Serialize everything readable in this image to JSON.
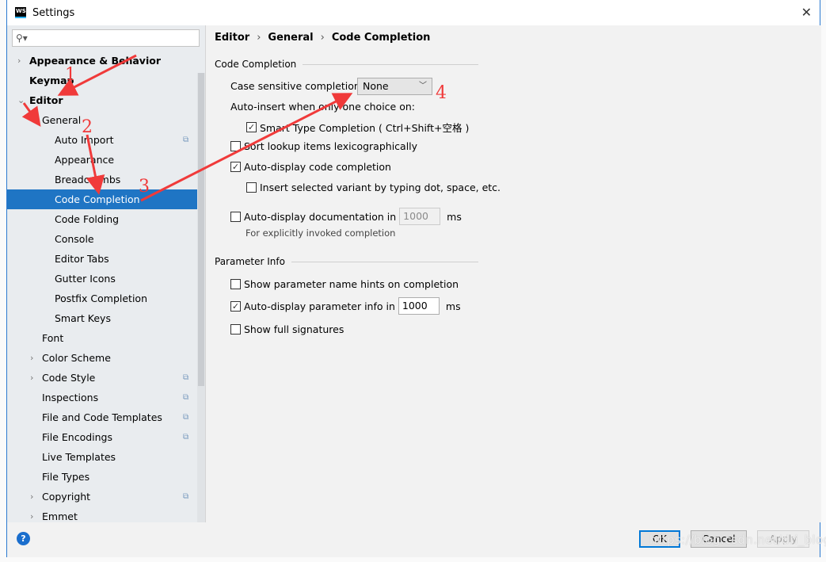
{
  "window": {
    "title": "Settings",
    "logo": "WS"
  },
  "search": {
    "placeholder": "",
    "icon": "search-icon"
  },
  "sidebar": {
    "items": [
      {
        "label": "Appearance & Behavior",
        "level": 0,
        "bold": true,
        "arrow": "›"
      },
      {
        "label": "Keymap",
        "level": 0,
        "bold": true,
        "arrow": ""
      },
      {
        "label": "Editor",
        "level": 0,
        "bold": true,
        "arrow": "⌄"
      },
      {
        "label": "General",
        "level": 1,
        "arrow": "⌄"
      },
      {
        "label": "Auto Import",
        "level": 2,
        "copy": true
      },
      {
        "label": "Appearance",
        "level": 2
      },
      {
        "label": "Breadcrumbs",
        "level": 2
      },
      {
        "label": "Code Completion",
        "level": 2,
        "selected": true
      },
      {
        "label": "Code Folding",
        "level": 2
      },
      {
        "label": "Console",
        "level": 2
      },
      {
        "label": "Editor Tabs",
        "level": 2
      },
      {
        "label": "Gutter Icons",
        "level": 2
      },
      {
        "label": "Postfix Completion",
        "level": 2
      },
      {
        "label": "Smart Keys",
        "level": 2
      },
      {
        "label": "Font",
        "level": 1
      },
      {
        "label": "Color Scheme",
        "level": 1,
        "arrow": "›"
      },
      {
        "label": "Code Style",
        "level": 1,
        "arrow": "›",
        "copy": true
      },
      {
        "label": "Inspections",
        "level": 1,
        "copy": true
      },
      {
        "label": "File and Code Templates",
        "level": 1,
        "copy": true
      },
      {
        "label": "File Encodings",
        "level": 1,
        "copy": true
      },
      {
        "label": "Live Templates",
        "level": 1
      },
      {
        "label": "File Types",
        "level": 1
      },
      {
        "label": "Copyright",
        "level": 1,
        "arrow": "›",
        "copy": true
      },
      {
        "label": "Emmet",
        "level": 1,
        "arrow": "›"
      }
    ]
  },
  "breadcrumb": [
    "Editor",
    "General",
    "Code Completion"
  ],
  "code_completion": {
    "section": "Code Completion",
    "case_label": "Case sensitive completion:",
    "case_value": "None",
    "auto_insert_label": "Auto-insert when only one choice on:",
    "smart_type": {
      "label": "Smart Type Completion ( Ctrl+Shift+空格 )",
      "checked": true
    },
    "sort_lookup": {
      "label": "Sort lookup items lexicographically",
      "checked": false
    },
    "auto_display": {
      "label": "Auto-display code completion",
      "checked": true
    },
    "insert_variant": {
      "label": "Insert selected variant by typing dot, space, etc.",
      "checked": false
    },
    "auto_doc": {
      "label": "Auto-display documentation in",
      "checked": false,
      "value": "1000",
      "unit": "ms"
    },
    "auto_doc_hint": "For explicitly invoked completion"
  },
  "parameter_info": {
    "section": "Parameter Info",
    "name_hints": {
      "label": "Show parameter name hints on completion",
      "checked": false
    },
    "auto_display": {
      "label": "Auto-display parameter info in",
      "checked": true,
      "value": "1000",
      "unit": "ms"
    },
    "full_signatures": {
      "label": "Show full signatures",
      "checked": false
    }
  },
  "buttons": {
    "ok": "OK",
    "cancel": "Cancel",
    "apply": "Apply",
    "help": "?"
  },
  "watermark": "https://blog.csdn.net/dri_blogs",
  "annotations": {
    "labels": [
      "1",
      "2",
      "3",
      "4"
    ],
    "color": "#f03a3a"
  }
}
